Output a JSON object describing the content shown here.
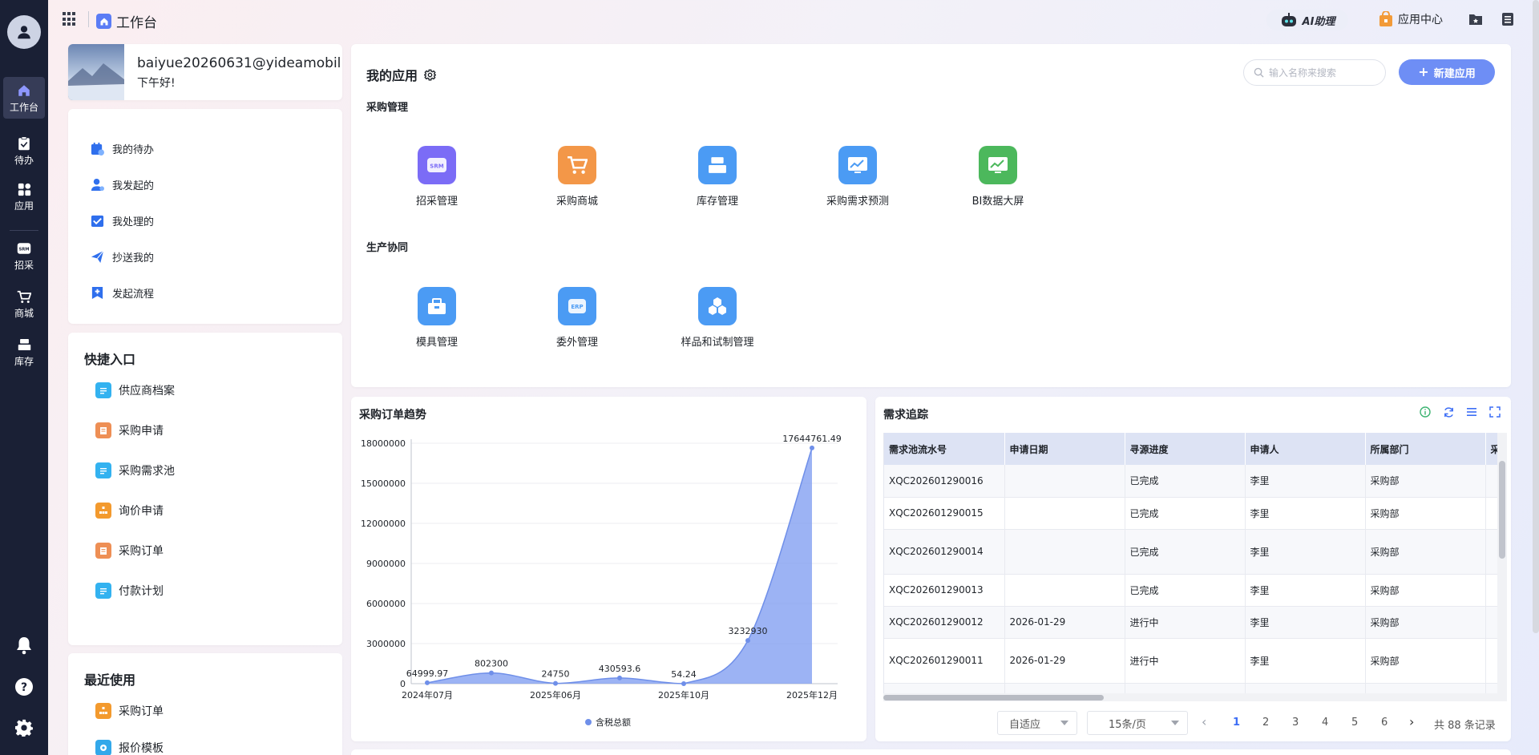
{
  "topbar": {
    "title": "工作台",
    "ai_label": "AI助理",
    "app_center": "应用中心"
  },
  "nav": {
    "items": [
      {
        "label": "工作台",
        "icon": "home-icon"
      },
      {
        "label": "待办",
        "icon": "clipboard-check-icon"
      },
      {
        "label": "应用",
        "icon": "apps-grid-icon"
      },
      {
        "label": "招采",
        "icon": "srm-icon"
      },
      {
        "label": "商城",
        "icon": "cart-icon"
      },
      {
        "label": "库存",
        "icon": "inventory-icon"
      }
    ]
  },
  "profile": {
    "username": "baiyue20260631@yideamobil",
    "greeting": "下午好!"
  },
  "tasks": [
    {
      "label": "我的待办"
    },
    {
      "label": "我发起的"
    },
    {
      "label": "我处理的"
    },
    {
      "label": "抄送我的"
    },
    {
      "label": "发起流程"
    }
  ],
  "quick": {
    "title": "快捷入口",
    "items": [
      {
        "label": "供应商档案"
      },
      {
        "label": "采购申请"
      },
      {
        "label": "采购需求池"
      },
      {
        "label": "询价申请"
      },
      {
        "label": "采购订单"
      },
      {
        "label": "付款计划"
      }
    ]
  },
  "recent": {
    "title": "最近使用",
    "items": [
      {
        "label": "采购订单"
      },
      {
        "label": "报价模板"
      }
    ]
  },
  "myapps": {
    "title": "我的应用",
    "search_placeholder": "输入名称来搜索",
    "new_label": "新建应用",
    "groups": [
      {
        "title": "采购管理",
        "apps": [
          {
            "label": "招采管理",
            "icon_text": "SRM",
            "color": "#7b6cf6"
          },
          {
            "label": "采购商城",
            "icon_text": "",
            "color": "#f39748"
          },
          {
            "label": "库存管理",
            "icon_text": "",
            "color": "#4b9bf4"
          },
          {
            "label": "采购需求预测",
            "icon_text": "",
            "color": "#4b9bf4"
          },
          {
            "label": "BI数据大屏",
            "icon_text": "",
            "color": "#4cb85c"
          }
        ]
      },
      {
        "title": "生产协同",
        "apps": [
          {
            "label": "模具管理",
            "icon_text": "",
            "color": "#4b9bf4"
          },
          {
            "label": "委外管理",
            "icon_text": "ERP",
            "color": "#4b9bf4"
          },
          {
            "label": "样品和试制管理",
            "icon_text": "",
            "color": "#4b9bf4"
          }
        ]
      }
    ]
  },
  "trend": {
    "title": "采购订单趋势"
  },
  "chart_data": {
    "type": "area",
    "title": "采购订单趋势",
    "x": [
      "2024年07月",
      "",
      "2025年06月",
      "",
      "2025年10月",
      "",
      "2025年12月"
    ],
    "x_tick_labels": [
      "2024年07月",
      "2025年06月",
      "2025年10月",
      "2025年12月"
    ],
    "series": [
      {
        "name": "含税总额",
        "values": [
          64999.97,
          802300,
          24750,
          430593.6,
          54.24,
          3232930,
          17644761.49
        ],
        "labels": [
          "64999.97",
          "802300",
          "24750",
          "430593.6",
          "54.24",
          "3232930",
          "17644761.49"
        ]
      }
    ],
    "ylim": [
      0,
      18000000
    ],
    "y_ticks": [
      "0",
      "3000000",
      "6000000",
      "9000000",
      "12000000",
      "15000000",
      "18000000"
    ],
    "grid": true,
    "legend": "bottom",
    "color": "#7b9af0"
  },
  "track": {
    "title": "需求追踪",
    "columns": [
      "需求池流水号",
      "申请日期",
      "寻源进度",
      "申请人",
      "所属部门",
      "采"
    ],
    "rows": [
      [
        "XQC202601290016",
        "",
        "已完成",
        "李里",
        "采购部"
      ],
      [
        "XQC202601290015",
        "",
        "已完成",
        "李里",
        "采购部"
      ],
      [
        "XQC202601290014",
        "",
        "已完成",
        "李里",
        "采购部"
      ],
      [
        "XQC202601290013",
        "",
        "已完成",
        "李里",
        "采购部"
      ],
      [
        "XQC202601290012",
        "2026-01-29",
        "进行中",
        "李里",
        "采购部"
      ],
      [
        "XQC202601290011",
        "2026-01-29",
        "进行中",
        "李里",
        "采购部"
      ],
      [
        "",
        "",
        "",
        "",
        ""
      ]
    ],
    "pager": {
      "fit": "自适应",
      "per_page": "15条/页",
      "pages": [
        "1",
        "2",
        "3",
        "4",
        "5",
        "6"
      ],
      "total": "共 88 条记录"
    }
  }
}
